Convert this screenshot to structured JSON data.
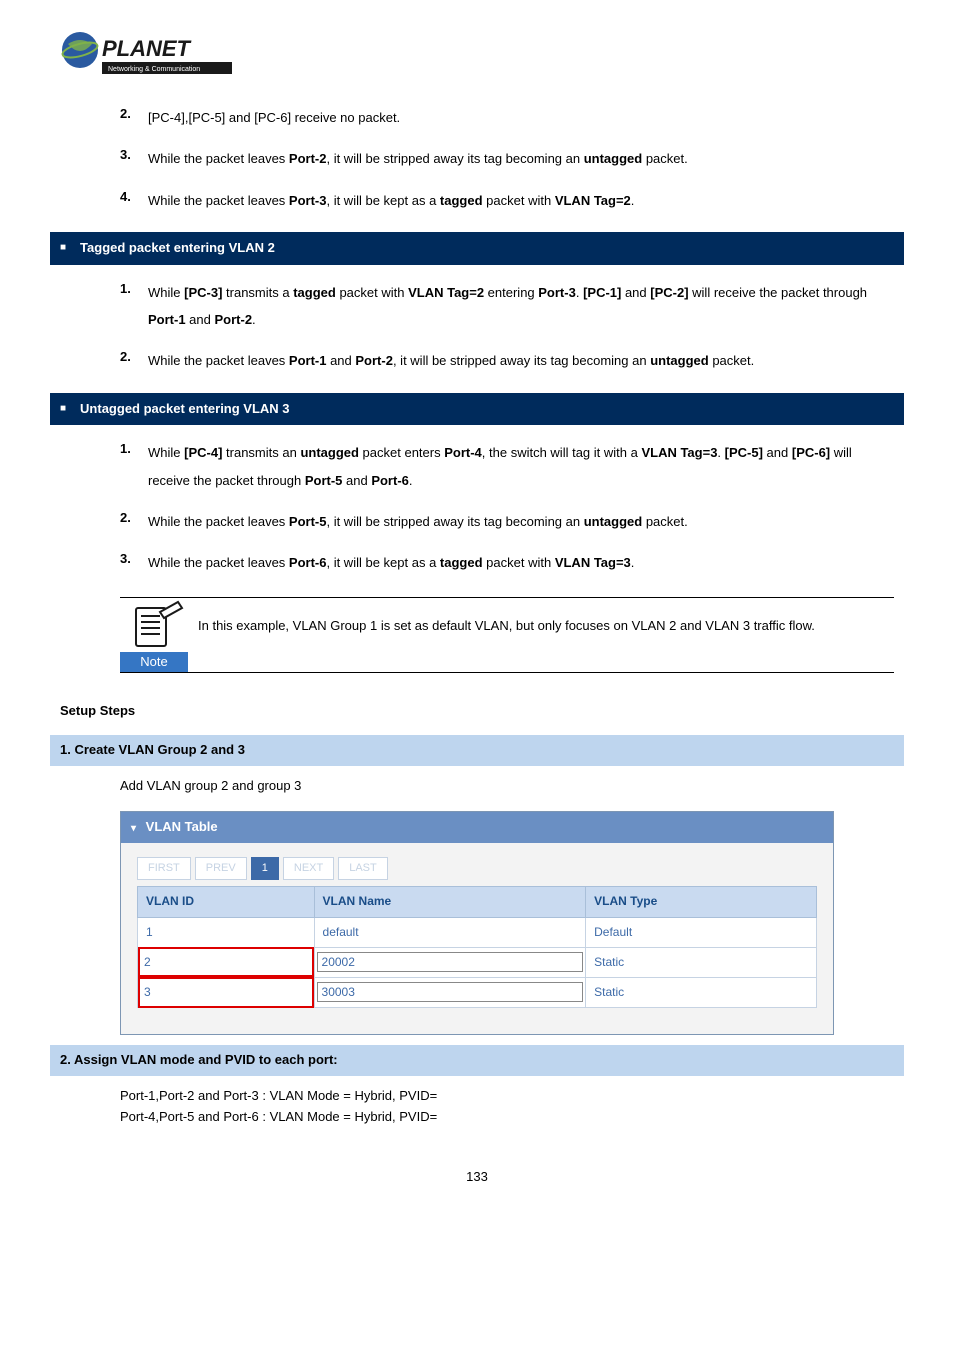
{
  "logo": {
    "brand": "PLANET",
    "tagline": "Networking & Communication"
  },
  "top_list": [
    {
      "num": "2.",
      "html": "[PC-4],[PC-5] and [PC-6] receive no packet."
    },
    {
      "num": "3.",
      "html": "While the packet leaves <b>Port-2</b>, it will be stripped away its tag becoming an <b>untagged</b> packet."
    },
    {
      "num": "4.",
      "html": "While the packet leaves <b>Port-3</b>, it will be kept as a <b>tagged</b> packet with <b>VLAN Tag=2</b>."
    }
  ],
  "section_tagged": {
    "title": "Tagged packet entering VLAN 2",
    "items": [
      {
        "num": "1.",
        "html": "While <b>[PC-3]</b> transmits a <b>tagged</b> packet with <b>VLAN Tag=2</b> entering <b>Port-3</b>. <b>[PC-1]</b> and <b>[PC-2]</b> will receive the packet through <b>Port-1</b> and <b>Port-2</b>."
      },
      {
        "num": "2.",
        "html": "While the packet leaves <b>Port-1</b> and <b>Port-2</b>, it will be stripped away its tag becoming an <b>untagged</b> packet."
      }
    ]
  },
  "section_untagged": {
    "title": "Untagged packet entering VLAN 3",
    "items": [
      {
        "num": "1.",
        "html": "While <b>[PC-4]</b> transmits an <b>untagged</b> packet enters <b>Port-4</b>, the switch will tag it with a <b>VLAN Tag=3</b>. <b>[PC-5]</b> and <b>[PC-6]</b> will receive the packet through <b>Port-5</b> and <b>Port-6</b>."
      },
      {
        "num": "2.",
        "html": "While the packet leaves <b>Port-5</b>, it will be stripped away its tag becoming an <b>untagged</b> packet."
      },
      {
        "num": "3.",
        "html": "While the packet leaves <b>Port-6</b>, it will be kept as a <b>tagged</b> packet with <b>VLAN Tag=3</b>."
      }
    ]
  },
  "note": {
    "label": "Note",
    "text": "In this example, VLAN Group 1 is set as default VLAN, but only focuses on VLAN 2 and VLAN 3 traffic flow."
  },
  "setup": {
    "heading": "Setup Steps",
    "step1": {
      "title": "1.   Create VLAN Group 2 and 3",
      "body": "Add VLAN group 2 and group 3"
    },
    "step2": {
      "title": "2.   Assign VLAN mode and PVID to each port:",
      "line1": "Port-1,Port-2 and Port-3 : VLAN Mode = Hybrid, PVID=",
      "line2": "Port-4,Port-5 and Port-6 : VLAN Mode = Hybrid, PVID="
    }
  },
  "vlan_table": {
    "panel_title": "VLAN Table",
    "pager": {
      "first": "FIRST",
      "prev": "PREV",
      "page": "1",
      "next": "NEXT",
      "last": "LAST"
    },
    "headers": {
      "id": "VLAN ID",
      "name": "VLAN Name",
      "type": "VLAN Type"
    },
    "rows": [
      {
        "id": "1",
        "name": "default",
        "type": "Default",
        "hl": false
      },
      {
        "id": "2",
        "name": "20002",
        "type": "Static",
        "hl": true
      },
      {
        "id": "3",
        "name": "30003",
        "type": "Static",
        "hl": true
      }
    ]
  },
  "page_number": "133"
}
